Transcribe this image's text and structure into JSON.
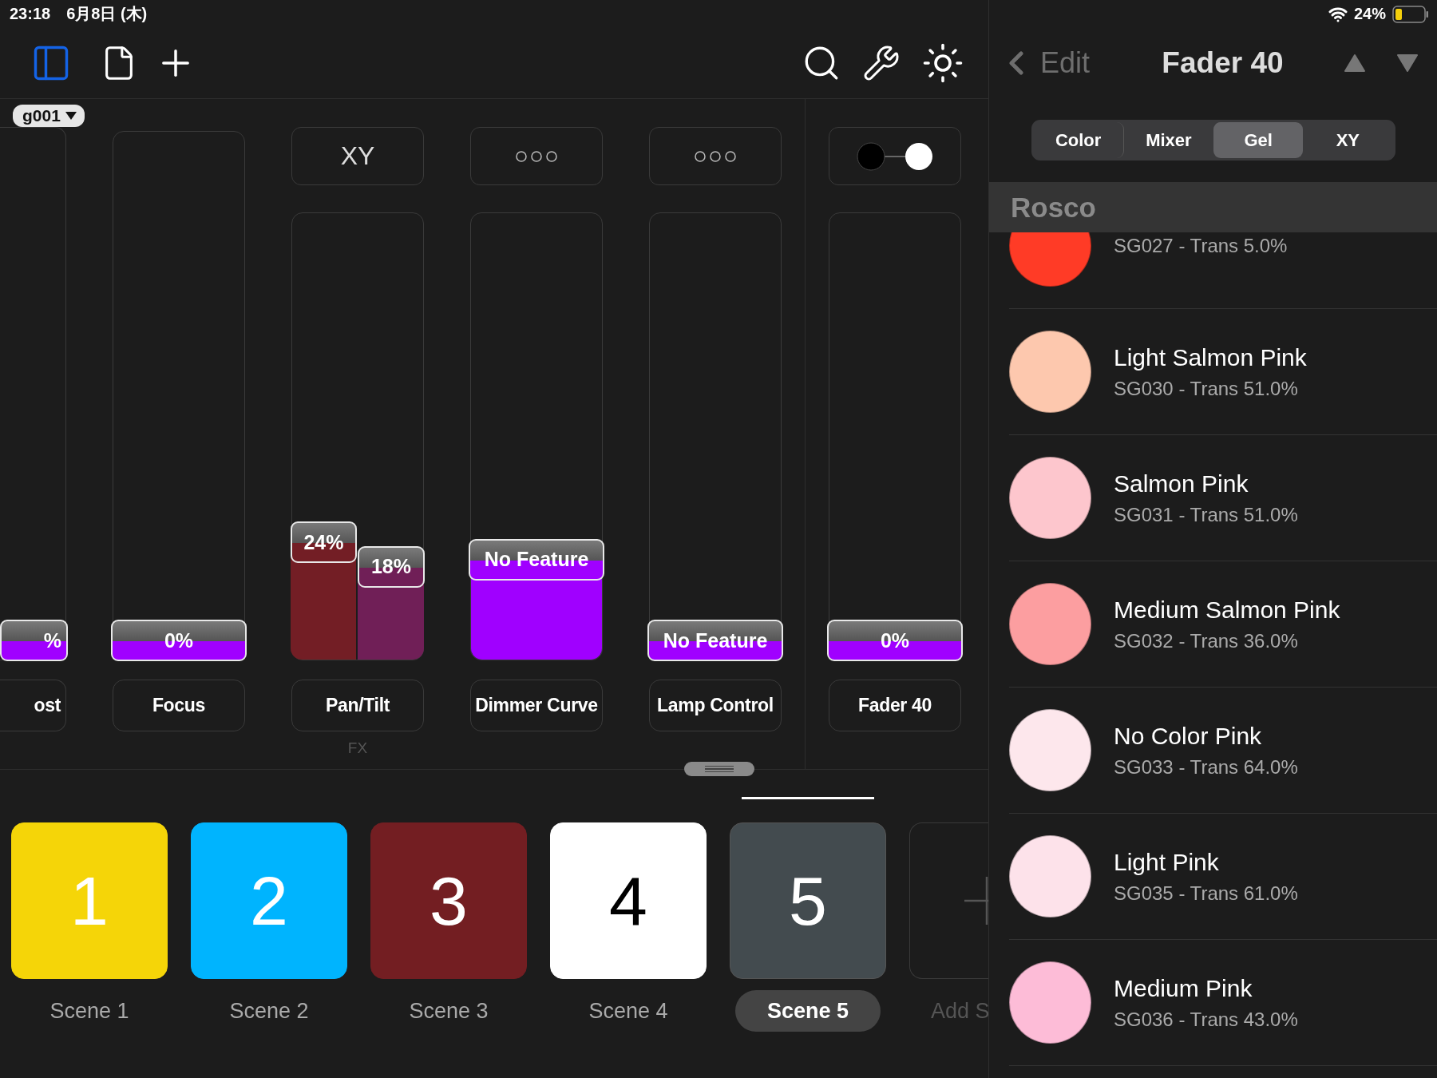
{
  "status_bar": {
    "time": "23:18",
    "date": "6月8日 (木)",
    "battery": "24%"
  },
  "group_selector": {
    "label": "g001"
  },
  "faders": [
    {
      "kind": "partial",
      "header": {
        "kind": "none"
      },
      "handle": "%",
      "level": 0,
      "label": "ost"
    },
    {
      "kind": "single",
      "header": {
        "kind": "none"
      },
      "handle": "0%",
      "level": 0,
      "label": "Focus"
    },
    {
      "kind": "split",
      "header": {
        "kind": "text",
        "text": "XY"
      },
      "bars": [
        {
          "handle": "24%",
          "level": 0.24,
          "color": "#731e25"
        },
        {
          "handle": "18%",
          "level": 0.18,
          "color": "#701f57"
        }
      ],
      "label": "Pan/Tilt",
      "caption": "FX"
    },
    {
      "kind": "single",
      "header": {
        "kind": "dots"
      },
      "handle": "No Feature",
      "level": 0.2,
      "label": "Dimmer Curve"
    },
    {
      "kind": "single",
      "header": {
        "kind": "dots"
      },
      "handle": "No Feature",
      "level": 0,
      "label": "Lamp Control"
    }
  ],
  "current_fader": {
    "kind": "single",
    "header": {
      "kind": "toggle"
    },
    "handle": "0%",
    "level": 0,
    "label": "Fader 40"
  },
  "scenes": [
    {
      "kind": "scene",
      "number": "1",
      "name": "Scene 1",
      "color": "#f5d508",
      "selected": false
    },
    {
      "kind": "scene",
      "number": "2",
      "name": "Scene 2",
      "color": "#00b4fe",
      "selected": false
    },
    {
      "kind": "scene",
      "number": "3",
      "name": "Scene 3",
      "color": "#731e22",
      "selected": false
    },
    {
      "kind": "scene",
      "number": "4",
      "name": "Scene 4",
      "color": "#ffffff",
      "selected": false
    },
    {
      "kind": "scene",
      "number": "5",
      "name": "Scene 5",
      "color": "#434b4f",
      "selected": true
    },
    {
      "kind": "add",
      "name": "Add S",
      "selected": false
    }
  ],
  "nav": {
    "back": "Edit",
    "title": "Fader 40"
  },
  "segments": [
    {
      "label": "Color",
      "selected": false
    },
    {
      "label": "Mixer",
      "selected": false
    },
    {
      "label": "Gel",
      "selected": true
    },
    {
      "label": "XY",
      "selected": false
    }
  ],
  "section": "Rosco",
  "gels": [
    {
      "code": "SG027 - Trans 5.0%",
      "color": "#ff3b26"
    },
    {
      "name": "Light Salmon Pink",
      "code": "SG030 - Trans 51.0%",
      "color": "#fdc8ae"
    },
    {
      "name": "Salmon Pink",
      "code": "SG031 - Trans 51.0%",
      "color": "#fdc6cd"
    },
    {
      "name": "Medium Salmon Pink",
      "code": "SG032 - Trans 36.0%",
      "color": "#fc9ea0"
    },
    {
      "name": "No Color Pink",
      "code": "SG033 - Trans 64.0%",
      "color": "#fde7ec"
    },
    {
      "name": "Light Pink",
      "code": "SG035 - Trans 61.0%",
      "color": "#fde2ea"
    },
    {
      "name": "Medium Pink",
      "code": "SG036 - Trans 43.0%",
      "color": "#fdbcd7"
    }
  ]
}
